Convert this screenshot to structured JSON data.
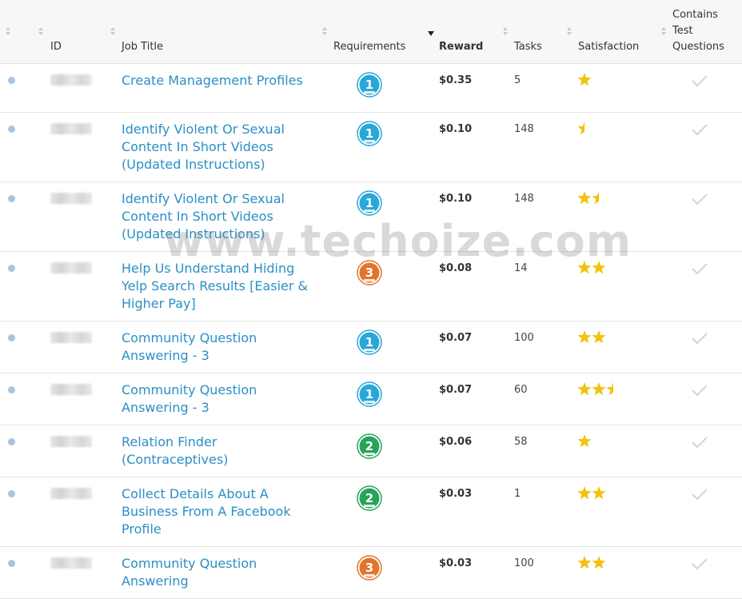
{
  "header": {
    "id": "ID",
    "job_title": "Job Title",
    "requirements": "Requirements",
    "reward": "Reward",
    "tasks": "Tasks",
    "satisfaction": "Satisfaction",
    "contains_line1": "Contains",
    "contains_line2": "Test",
    "contains_line3": "Questions"
  },
  "watermark": "www.techoize.com",
  "colors": {
    "link": "#2a8fc6",
    "level1": "#2aa7d8",
    "level2": "#27a35a",
    "level3": "#e2742e",
    "star": "#f4c20d"
  },
  "rows": [
    {
      "title_lines": [
        "Create Management Profiles"
      ],
      "level": "1",
      "reward": "$0.35",
      "tasks": "5",
      "stars": 1
    },
    {
      "title_lines": [
        "Identify Violent Or Sexual",
        "Content In Short Videos",
        "(Updated Instructions)"
      ],
      "level": "1",
      "reward": "$0.10",
      "tasks": "148",
      "stars": 0.5
    },
    {
      "title_lines": [
        "Identify Violent Or Sexual",
        "Content In Short Videos",
        "(Updated Instructions)"
      ],
      "level": "1",
      "reward": "$0.10",
      "tasks": "148",
      "stars": 1.5
    },
    {
      "title_lines": [
        "Help Us Understand Hiding",
        "Yelp Search Results [Easier &",
        "Higher Pay]"
      ],
      "level": "3",
      "reward": "$0.08",
      "tasks": "14",
      "stars": 2
    },
    {
      "title_lines": [
        "Community Question",
        "Answering - 3"
      ],
      "level": "1",
      "reward": "$0.07",
      "tasks": "100",
      "stars": 2
    },
    {
      "title_lines": [
        "Community Question",
        "Answering - 3"
      ],
      "level": "1",
      "reward": "$0.07",
      "tasks": "60",
      "stars": 2.5
    },
    {
      "title_lines": [
        "Relation Finder",
        "(Contraceptives)"
      ],
      "level": "2",
      "reward": "$0.06",
      "tasks": "58",
      "stars": 1
    },
    {
      "title_lines": [
        "Collect Details About A",
        "Business From A Facebook",
        "Profile"
      ],
      "level": "2",
      "reward": "$0.03",
      "tasks": "1",
      "stars": 2
    },
    {
      "title_lines": [
        "Community Question",
        "Answering"
      ],
      "level": "3",
      "reward": "$0.03",
      "tasks": "100",
      "stars": 2
    }
  ]
}
